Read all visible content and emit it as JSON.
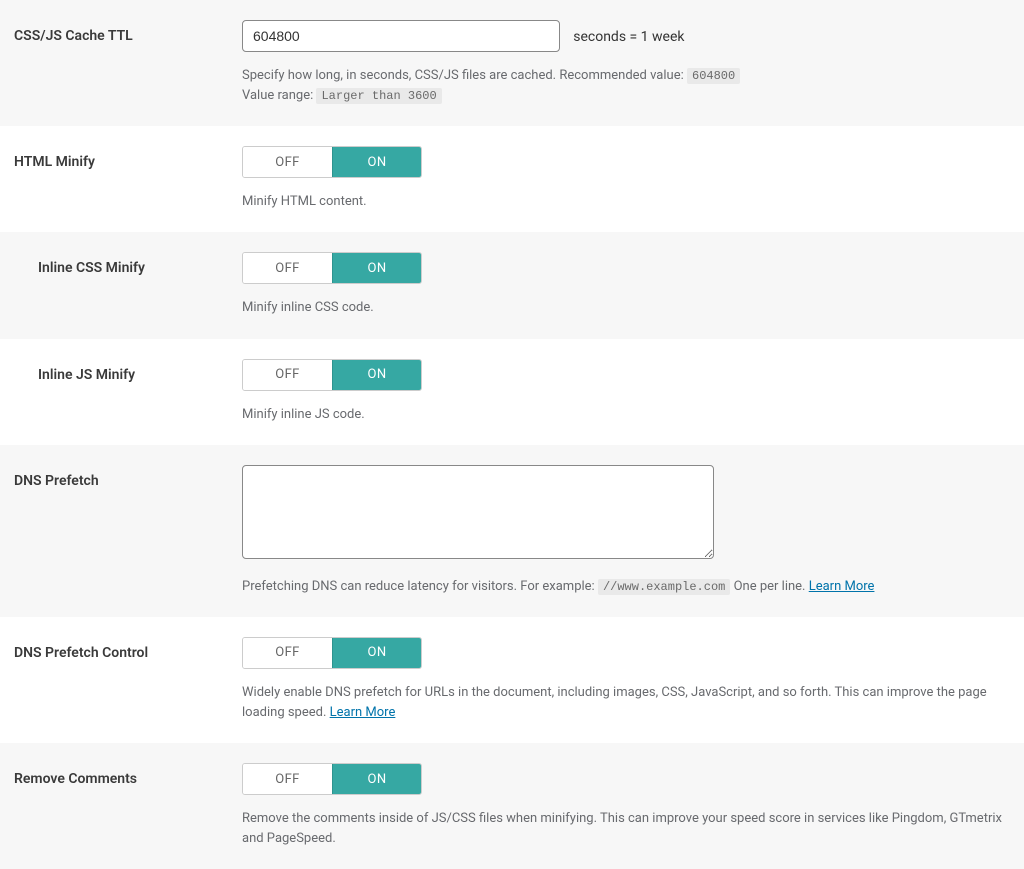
{
  "toggle": {
    "off": "OFF",
    "on": "ON"
  },
  "settings": {
    "cache_ttl": {
      "label": "CSS/JS Cache TTL",
      "value": "604800",
      "suffix": "seconds = 1 week",
      "help1": "Specify how long, in seconds, CSS/JS files are cached. Recommended value:",
      "help1_code": "604800",
      "help2": "Value range:",
      "help2_code": "Larger than 3600"
    },
    "html_minify": {
      "label": "HTML Minify",
      "help": "Minify HTML content."
    },
    "inline_css_minify": {
      "label": "Inline CSS Minify",
      "help": "Minify inline CSS code."
    },
    "inline_js_minify": {
      "label": "Inline JS Minify",
      "help": "Minify inline JS code."
    },
    "dns_prefetch": {
      "label": "DNS Prefetch",
      "value": "",
      "help_before": "Prefetching DNS can reduce latency for visitors. For example:",
      "help_code": "//www.example.com",
      "help_after": "One per line.",
      "learn_more": "Learn More"
    },
    "dns_prefetch_control": {
      "label": "DNS Prefetch Control",
      "help": "Widely enable DNS prefetch for URLs in the document, including images, CSS, JavaScript, and so forth. This can improve the page loading speed.",
      "learn_more": "Learn More"
    },
    "remove_comments": {
      "label": "Remove Comments",
      "help": "Remove the comments inside of JS/CSS files when minifying. This can improve your speed score in services like Pingdom, GTmetrix and PageSpeed."
    }
  }
}
